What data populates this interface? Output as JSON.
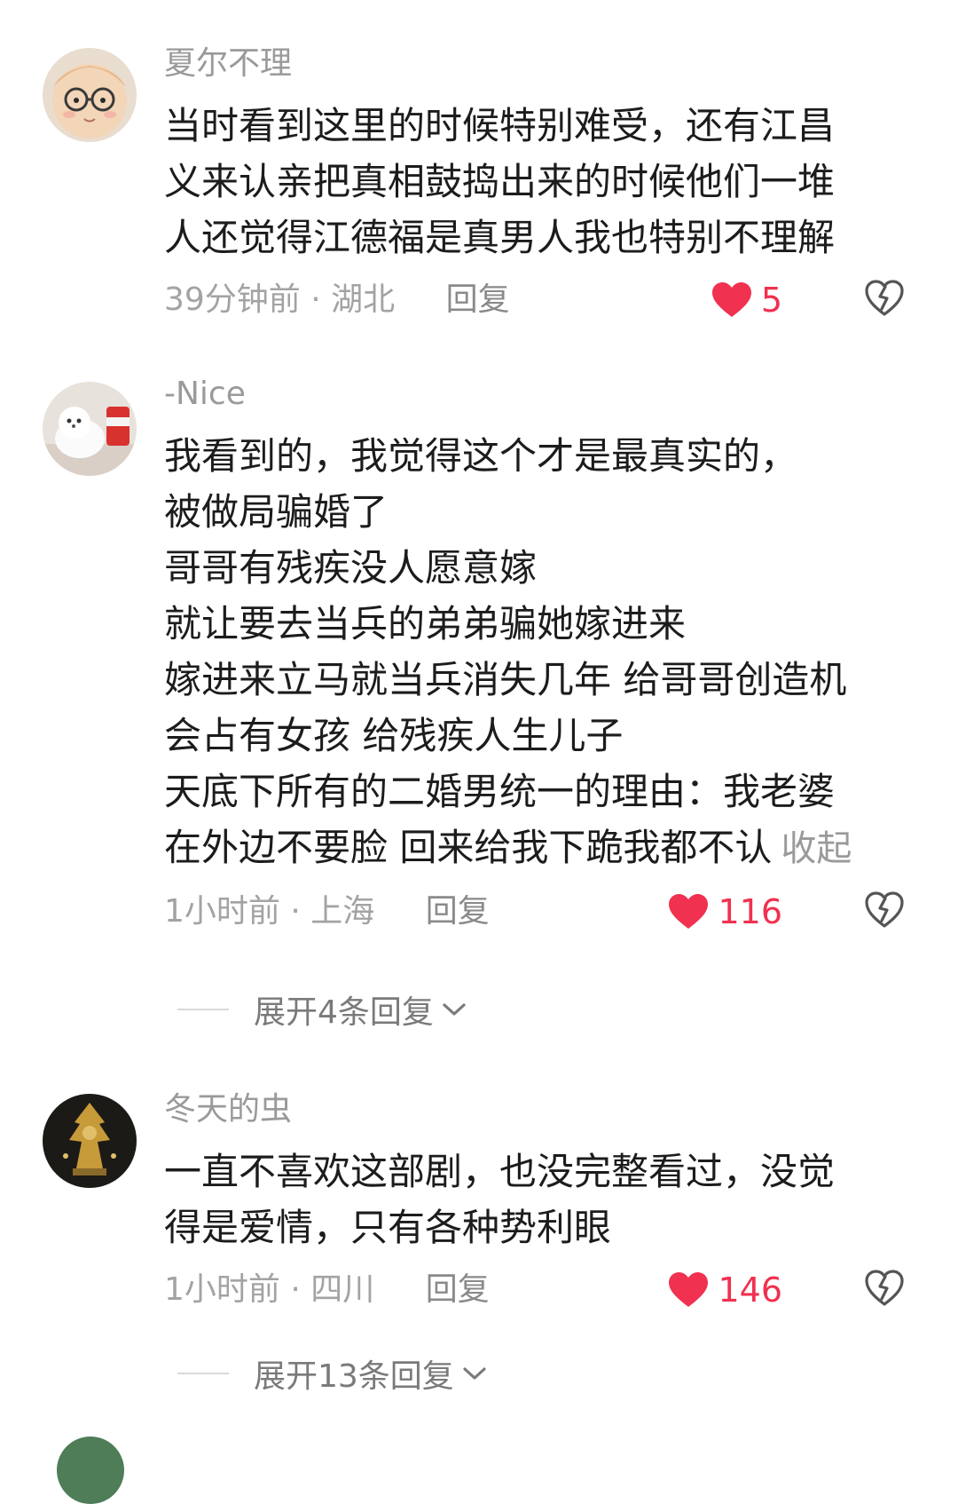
{
  "comments": [
    {
      "username": "夏尔不理",
      "avatar_icon": "avatar-cartoon-boy-with-glasses",
      "lines": [
        "当时看到这里的时候特别难受，还有江昌",
        "义来认亲把真相鼓捣出来的时候他们一堆",
        "人还觉得江德福是真男人我也特别不理解"
      ],
      "time_location": "39分钟前 · 湖北",
      "reply_label": "回复",
      "likes": "5"
    },
    {
      "username": "-Nice",
      "avatar_icon": "avatar-white-puppy",
      "lines": [
        "我看到的，我觉得这个才是最真实的，",
        "被做局骗婚了",
        "哥哥有残疾没人愿意嫁",
        "就让要去当兵的弟弟骗她嫁进来",
        "嫁进来立马就当兵消失几年 给哥哥创造机",
        "会占有女孩 给残疾人生儿子",
        "天底下所有的二婚男统一的理由：我老婆",
        "在外边不要脸 回来给我下跪我都不认"
      ],
      "collapse_label": "收起",
      "time_location": "1小时前 · 上海",
      "reply_label": "回复",
      "likes": "116",
      "expand_replies": "展开4条回复"
    },
    {
      "username": "冬天的虫",
      "avatar_icon": "avatar-golden-artifact",
      "lines": [
        "一直不喜欢这部剧，也没完整看过，没觉",
        "得是爱情，只有各种势利眼"
      ],
      "time_location": "1小时前 · 四川",
      "reply_label": "回复",
      "likes": "146",
      "expand_replies": "展开13条回复"
    }
  ],
  "icons": {
    "like": "heart-icon",
    "dislike": "broken-heart-icon",
    "expand": "chevron-down-icon"
  },
  "colors": {
    "like_red": "#f0314f",
    "muted_text": "#9a9a9a",
    "body_text": "#1c1c1c"
  }
}
